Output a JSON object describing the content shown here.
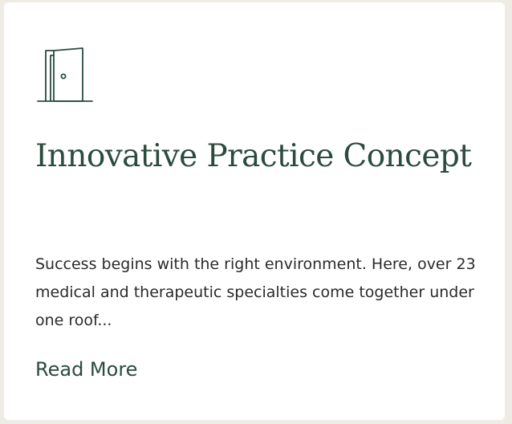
{
  "card": {
    "icon": "open-door-icon",
    "title": "Innovative Practice Concept",
    "description": "Success begins with the right environment. Here, over 23 medical and therapeutic specialties come together under one roof...",
    "link_label": "Read More"
  },
  "colors": {
    "accent": "#2a4b3d",
    "body_text": "#2a2a2a",
    "card_bg": "#ffffff",
    "page_bg": "#efece5"
  }
}
